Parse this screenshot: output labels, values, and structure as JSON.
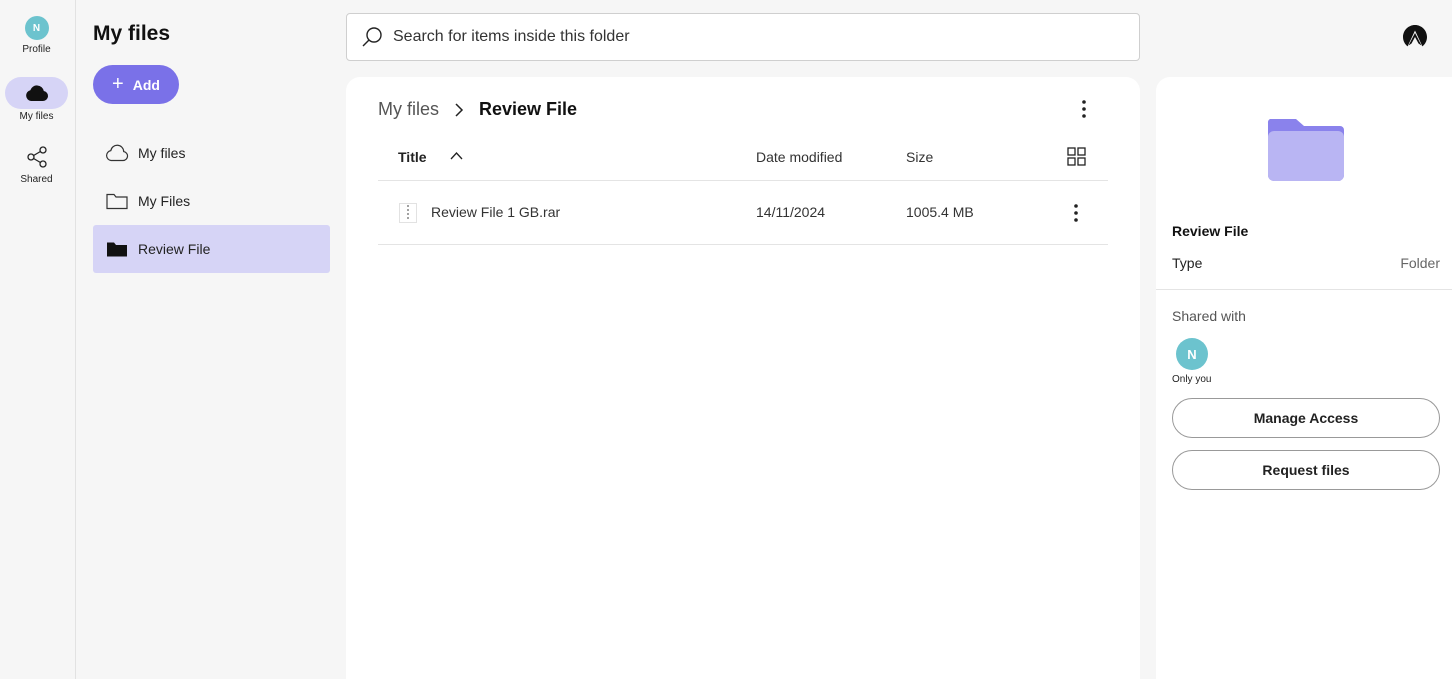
{
  "rail": {
    "profile_initial": "N",
    "profile_label": "Profile",
    "myfiles_label": "My files",
    "shared_label": "Shared"
  },
  "panel": {
    "title": "My files",
    "add_label": "Add",
    "tree": [
      {
        "label": "My files",
        "icon": "cloud-outline-icon"
      },
      {
        "label": "My Files",
        "icon": "folder-outline-icon"
      },
      {
        "label": "Review File",
        "icon": "folder-filled-icon",
        "active": true
      }
    ]
  },
  "search": {
    "placeholder": "Search for items inside this folder"
  },
  "breadcrumb": {
    "root": "My files",
    "current": "Review File"
  },
  "table": {
    "columns": {
      "title": "Title",
      "date": "Date modified",
      "size": "Size"
    },
    "rows": [
      {
        "name": "Review File 1 GB.rar",
        "date": "14/11/2024",
        "size": "1005.4 MB"
      }
    ]
  },
  "detail": {
    "name": "Review File",
    "type_label": "Type",
    "type_value": "Folder",
    "shared_label": "Shared with",
    "avatar_initial": "N",
    "avatar_caption": "Only you",
    "manage_access": "Manage Access",
    "request_files": "Request files"
  },
  "colors": {
    "accent": "#7a71e8",
    "accent_light": "#d6d4f6",
    "avatar": "#6cc3ce",
    "folder_icon": "#b9b5f3"
  }
}
